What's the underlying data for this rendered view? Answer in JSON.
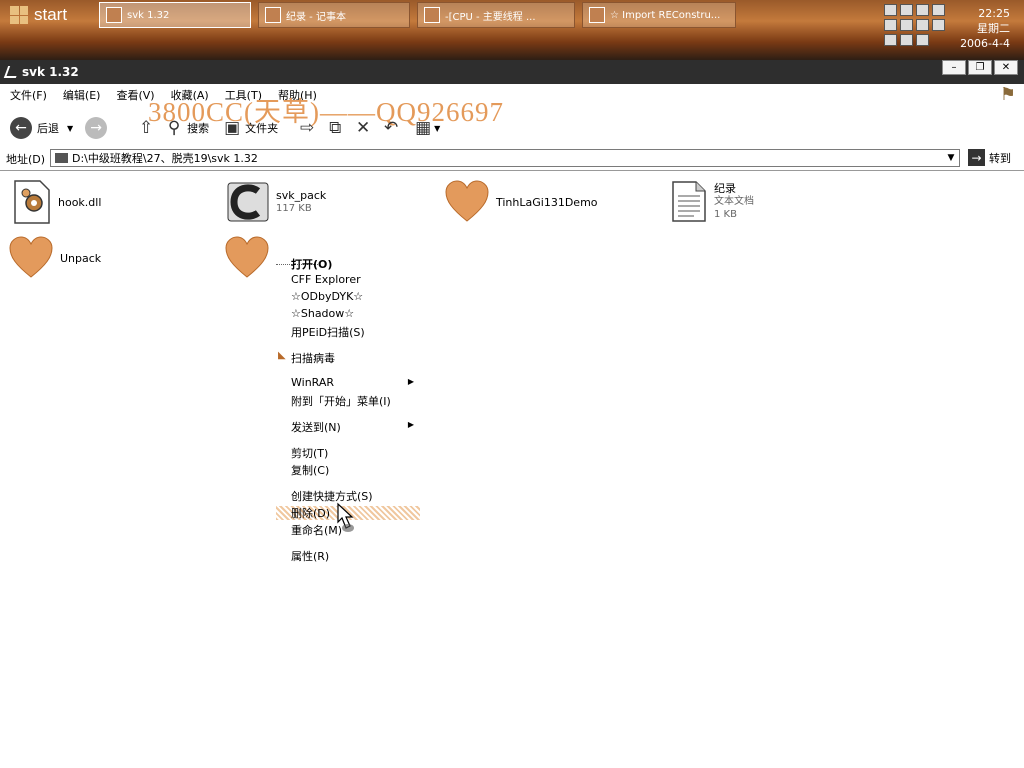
{
  "taskbar": {
    "start_label": "start",
    "tasks": [
      {
        "label": "svk 1.32"
      },
      {
        "label": "纪录 - 记事本"
      },
      {
        "label": "-[CPU - 主要线程 ..."
      },
      {
        "label": "☆ Import REConstru..."
      }
    ],
    "clock_time": "22:25",
    "clock_day": "星期二",
    "clock_date": "2006-4-4"
  },
  "window": {
    "title": "svk 1.32",
    "menu": [
      "文件(F)",
      "编辑(E)",
      "查看(V)",
      "收藏(A)",
      "工具(T)",
      "帮助(H)"
    ],
    "watermark": "3800CC(天草)——QQ926697",
    "toolbar": {
      "back": "后退",
      "search": "搜索",
      "folders": "文件夹"
    },
    "address_label": "地址(D)",
    "address_value": "D:\\中级班教程\\27、脱壳19\\svk 1.32",
    "go_label": "转到"
  },
  "files": [
    {
      "name": "hook.dll",
      "icon": "dll-gear-icon"
    },
    {
      "name": "svk_pack",
      "size": "117 KB",
      "icon": "exe-c-icon"
    },
    {
      "name": "TinhLaGi131Demo",
      "icon": "heart-icon"
    },
    {
      "name": "纪录",
      "type": "文本文档",
      "size": "1 KB",
      "icon": "text-document-icon"
    },
    {
      "name": "Unpack",
      "icon": "heart-icon"
    },
    {
      "name": "",
      "icon": "heart-icon"
    }
  ],
  "context_menu": [
    "打开(O)",
    "CFF Explorer",
    "☆ODbyDYK☆",
    "☆Shadow☆",
    "用PEiD扫描(S)",
    "扫描病毒",
    "WinRAR",
    "附到「开始」菜单(I)",
    "发送到(N)",
    "剪切(T)",
    "复制(C)",
    "创建快捷方式(S)",
    "删除(D)",
    "重命名(M)",
    "属性(R)"
  ]
}
